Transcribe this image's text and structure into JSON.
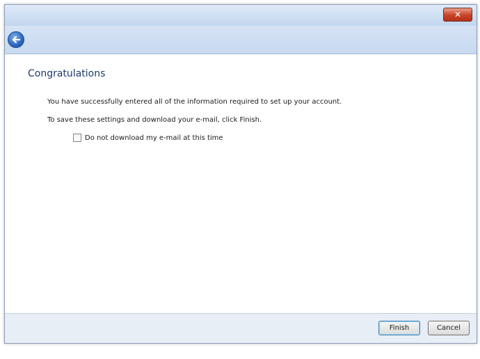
{
  "window": {
    "close_label": "✕"
  },
  "nav": {
    "back_icon": "back-arrow-icon"
  },
  "content": {
    "heading": "Congratulations",
    "line1": "You have successfully entered all of the information required to set up your account.",
    "line2": "To save these settings and download your e-mail, click Finish.",
    "checkbox_label": "Do not download my e-mail at this time",
    "checkbox_checked": false
  },
  "footer": {
    "finish_label": "Finish",
    "cancel_label": "Cancel"
  }
}
